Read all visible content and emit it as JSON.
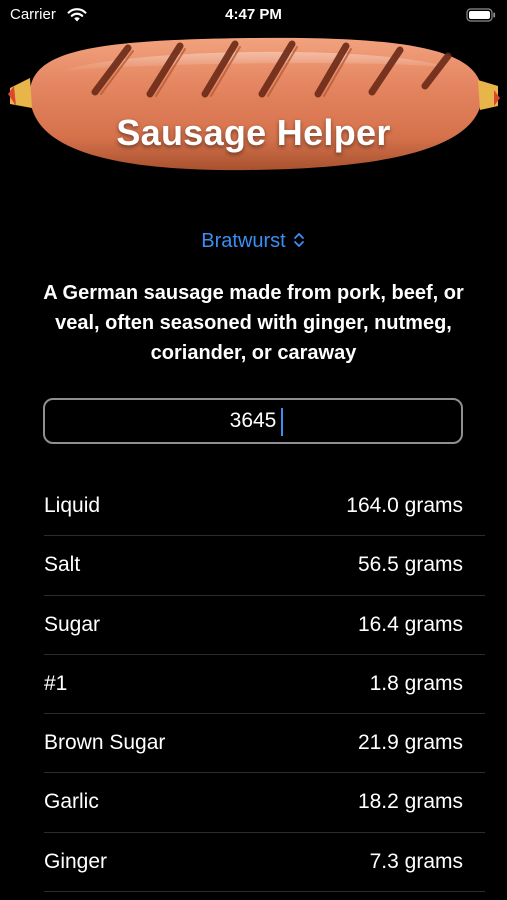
{
  "status_bar": {
    "carrier": "Carrier",
    "time": "4:47 PM",
    "wifi_icon": "wifi-icon",
    "battery_icon": "battery-icon"
  },
  "header": {
    "title": "Sausage Helper",
    "image": "sausage-image"
  },
  "picker": {
    "selected": "Bratwurst",
    "icon": "chevron-up-down-icon"
  },
  "description": "A German sausage made from pork, beef, or veal, often seasoned with ginger, nutmeg, coriander, or caraway",
  "weight_input": {
    "value": "3645"
  },
  "ingredients": [
    {
      "name": "Liquid",
      "amount": "164.0 grams"
    },
    {
      "name": "Salt",
      "amount": "56.5 grams"
    },
    {
      "name": "Sugar",
      "amount": "16.4 grams"
    },
    {
      "name": "#1",
      "amount": "1.8 grams"
    },
    {
      "name": "Brown Sugar",
      "amount": "21.9 grams"
    },
    {
      "name": "Garlic",
      "amount": "18.2 grams"
    },
    {
      "name": "Ginger",
      "amount": "7.3 grams"
    }
  ],
  "colors": {
    "background": "#000000",
    "accent": "#3a8ff5",
    "separator": "#2c2c2e",
    "sausage": "#e0835a"
  }
}
